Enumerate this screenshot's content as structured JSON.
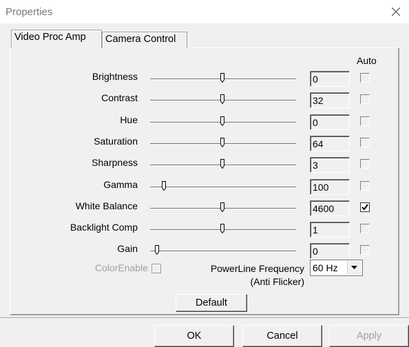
{
  "window": {
    "title": "Properties",
    "close_glyph": "×"
  },
  "tabs": [
    {
      "label": "Video Proc Amp",
      "active": true
    },
    {
      "label": "Camera Control",
      "active": false
    }
  ],
  "auto_header": "Auto",
  "controls": [
    {
      "label": "Brightness",
      "value": "0",
      "position": 0.5,
      "auto": false,
      "auto_enabled": false
    },
    {
      "label": "Contrast",
      "value": "32",
      "position": 0.5,
      "auto": false,
      "auto_enabled": false
    },
    {
      "label": "Hue",
      "value": "0",
      "position": 0.5,
      "auto": false,
      "auto_enabled": false
    },
    {
      "label": "Saturation",
      "value": "64",
      "position": 0.5,
      "auto": false,
      "auto_enabled": false
    },
    {
      "label": "Sharpness",
      "value": "3",
      "position": 0.5,
      "auto": false,
      "auto_enabled": false
    },
    {
      "label": "Gamma",
      "value": "100",
      "position": 0.08,
      "auto": false,
      "auto_enabled": false
    },
    {
      "label": "White Balance",
      "value": "4600",
      "position": 0.5,
      "auto": true,
      "auto_enabled": true
    },
    {
      "label": "Backlight Comp",
      "value": "1",
      "position": 0.5,
      "auto": false,
      "auto_enabled": false
    },
    {
      "label": "Gain",
      "value": "0",
      "position": 0.03,
      "auto": false,
      "auto_enabled": false
    }
  ],
  "color_enable": {
    "label": "ColorEnable",
    "checked": false,
    "enabled": false
  },
  "powerline": {
    "label_line1": "PowerLine Frequency",
    "label_line2": "(Anti Flicker)",
    "selected": "60 Hz"
  },
  "buttons": {
    "default": "Default",
    "ok": "OK",
    "cancel": "Cancel",
    "apply": "Apply",
    "apply_enabled": false
  }
}
